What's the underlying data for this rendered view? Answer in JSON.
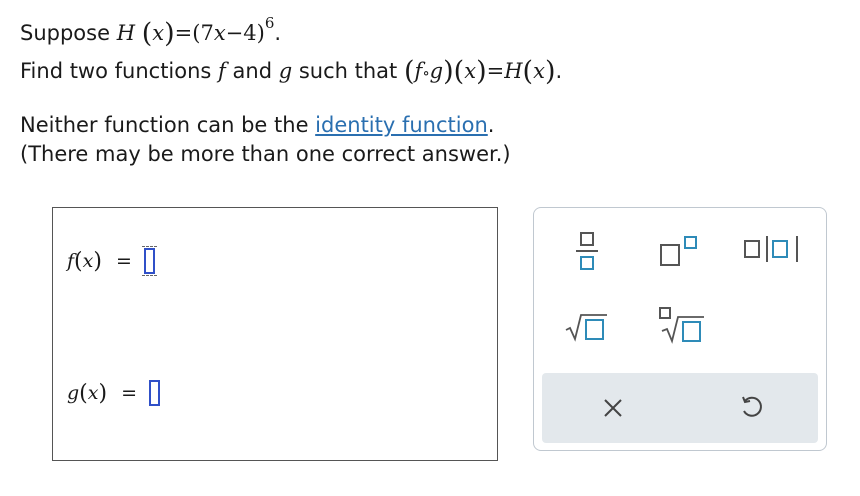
{
  "question": {
    "line1_prefix": "Suppose",
    "H": "H",
    "x": "x",
    "base_open": "(7",
    "minus_four": "−4)",
    "exponent": "6",
    "line1_end": ".",
    "line2_prefix": "Find two functions",
    "f": "f",
    "and": "and",
    "g": "g",
    "such_that": "such that",
    "compose": "∘",
    "equals": "=",
    "period": ".",
    "line3_prefix": "Neither function can be the",
    "identity_link": "identity function",
    "line3_end": ".",
    "line4": "(There may be more than one correct answer.)"
  },
  "answer": {
    "f_label": "f",
    "g_label": "g",
    "var": "x",
    "equals": "="
  },
  "palette": {
    "tools": [
      "fraction-icon",
      "exponent-icon",
      "absolute-value-icon",
      "square-root-icon",
      "nth-root-icon"
    ],
    "clear_symbol": "×",
    "undo_symbol": "↺"
  },
  "colors": {
    "link": "#2a6fb0",
    "input_border": "#3050c8",
    "palette_box": "#2e8bb8",
    "action_bar": "#e3e8ec"
  }
}
